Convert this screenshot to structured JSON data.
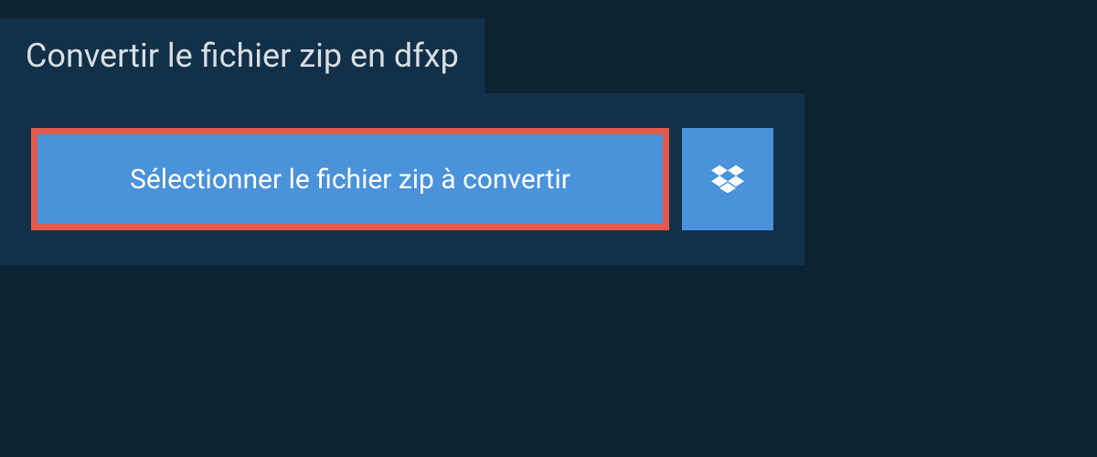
{
  "title": "Convertir le fichier zip en dfxp",
  "selectButton": {
    "label": "Sélectionner le fichier zip à convertir"
  },
  "dropbox": {
    "iconName": "dropbox-icon"
  },
  "colors": {
    "pageBg": "#0c2333",
    "panelBg": "#133049",
    "buttonBg": "#4a92d9",
    "highlightBorder": "#e15a4e",
    "textLight": "#d8dfe5",
    "white": "#ffffff"
  }
}
